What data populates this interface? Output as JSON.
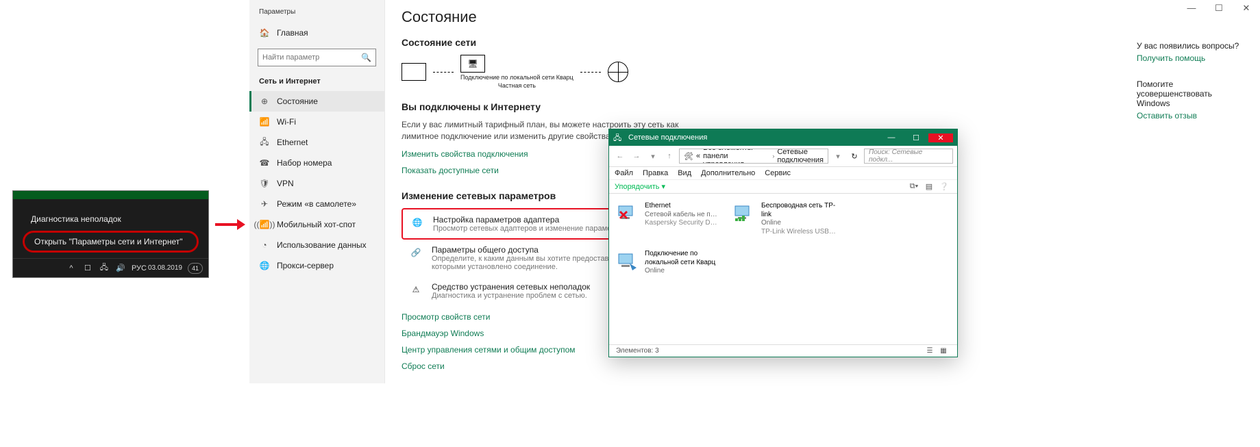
{
  "taskbar_popup": {
    "diagnose": "Диагностика неполадок",
    "open_settings": "Открыть \"Параметры сети и Интернет\"",
    "lang": "РУС",
    "date": "03.08.2019",
    "badge": "41"
  },
  "settings": {
    "sidebar": {
      "title": "Параметры",
      "home": "Главная",
      "search_placeholder": "Найти параметр",
      "section": "Сеть и Интернет",
      "items": [
        {
          "label": "Состояние"
        },
        {
          "label": "Wi-Fi"
        },
        {
          "label": "Ethernet"
        },
        {
          "label": "Набор номера"
        },
        {
          "label": "VPN"
        },
        {
          "label": "Режим «в самолете»"
        },
        {
          "label": "Мобильный хот-спот"
        },
        {
          "label": "Использование данных"
        },
        {
          "label": "Прокси-сервер"
        }
      ]
    },
    "content": {
      "page_title": "Состояние",
      "net_heading": "Состояние сети",
      "diagram": {
        "conn_name": "Подключение по локальной сети Кварц",
        "net_type": "Частная сеть"
      },
      "connected_heading": "Вы подключены к Интернету",
      "connected_body": "Если у вас лимитный тарифный план, вы можете настроить эту сеть как лимитное подключение или изменить другие свойства.",
      "link_props": "Изменить свойства подключения",
      "link_show": "Показать доступные сети",
      "change_heading": "Изменение сетевых параметров",
      "opt_adapter_title": "Настройка параметров адаптера",
      "opt_adapter_desc": "Просмотр сетевых адаптеров и изменение параметров подключения.",
      "opt_sharing_title": "Параметры общего доступа",
      "opt_sharing_desc": "Определите, к каким данным вы хотите предоставить доступ для сетей, с которыми установлено соединение.",
      "opt_troubleshoot_title": "Средство устранения сетевых неполадок",
      "opt_troubleshoot_desc": "Диагностика и устранение проблем с сетью.",
      "link_view_props": "Просмотр свойств сети",
      "link_firewall": "Брандмауэр Windows",
      "link_sharing_center": "Центр управления сетями и общим доступом",
      "link_reset": "Сброс сети"
    },
    "help": {
      "q1": "У вас появились вопросы?",
      "a1": "Получить помощь",
      "q2": "Помогите усовершенствовать Windows",
      "a2": "Оставить отзыв"
    }
  },
  "explorer": {
    "title": "Сетевые подключения",
    "breadcrumb": {
      "root_glyph": "«",
      "part1": "Все элементы панели управления",
      "part2": "Сетевые подключения"
    },
    "search_placeholder": "Поиск: Сетевые подкл...",
    "menus": [
      "Файл",
      "Правка",
      "Вид",
      "Дополнительно",
      "Сервис"
    ],
    "organize": "Упорядочить ▾",
    "connections": [
      {
        "name": "Ethernet",
        "status": "Сетевой кабель не подкл...",
        "detail": "Kaspersky Security Data Esc...",
        "state": "disconnected"
      },
      {
        "name": "Беспроводная сеть TP-link",
        "status": "Online",
        "detail": "TP-Link Wireless USB Adap...",
        "state": "wifi"
      },
      {
        "name": "Подключение по локальной сети Кварц",
        "status": "Online",
        "detail": "",
        "state": "lan"
      }
    ],
    "status": "Элементов: 3"
  }
}
